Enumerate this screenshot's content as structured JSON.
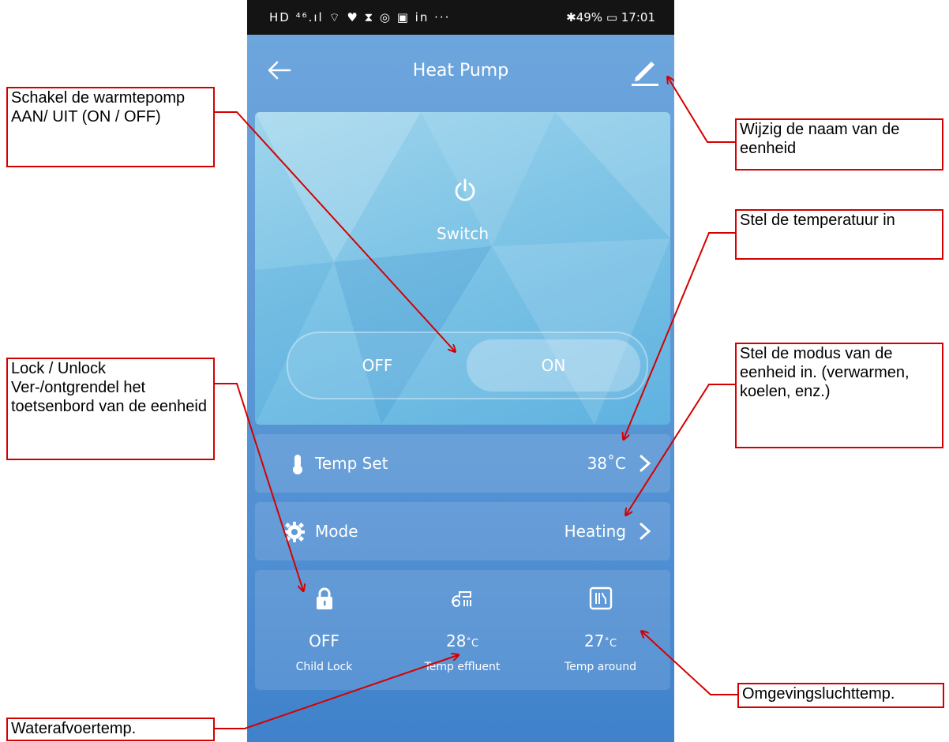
{
  "status_bar": {
    "left_icons": "HD ⁴⁶.ıl ⌔ ♥ ⧗ ◎ ▣ in ···",
    "battery": "✱49% ▭ 17:01"
  },
  "app": {
    "title": "Heat Pump"
  },
  "power": {
    "switch_label": "Switch",
    "off_label": "OFF",
    "on_label": "ON",
    "selected": "ON"
  },
  "temp_set": {
    "label": "Temp Set",
    "value": "38˚C"
  },
  "mode": {
    "label": "Mode",
    "value": "Heating"
  },
  "info": {
    "child_lock": {
      "value": "OFF",
      "label": "Child Lock"
    },
    "temp_effluent": {
      "value": "28",
      "unit": "˚C",
      "label": "Temp effluent"
    },
    "temp_around": {
      "value": "27",
      "unit": "˚C",
      "label": "Temp around"
    }
  },
  "annotations": {
    "switch": "Schakel de warmtepomp AAN/ UIT (ON / OFF)",
    "rename": "Wijzig de naam van de eenheid",
    "temperature": "Stel de temperatuur in",
    "lock": "Lock / Unlock Ver-/ontgrendel het toetsenbord van de eenheid",
    "mode": "Stel de modus van de eenheid in. (verwarmen, koelen, enz.)",
    "ambient": "Omgevingsluchttemp.",
    "effluent": "Waterafvoertemp."
  },
  "colors": {
    "annotation": "#d40000",
    "accent": "#5f9ad6"
  }
}
